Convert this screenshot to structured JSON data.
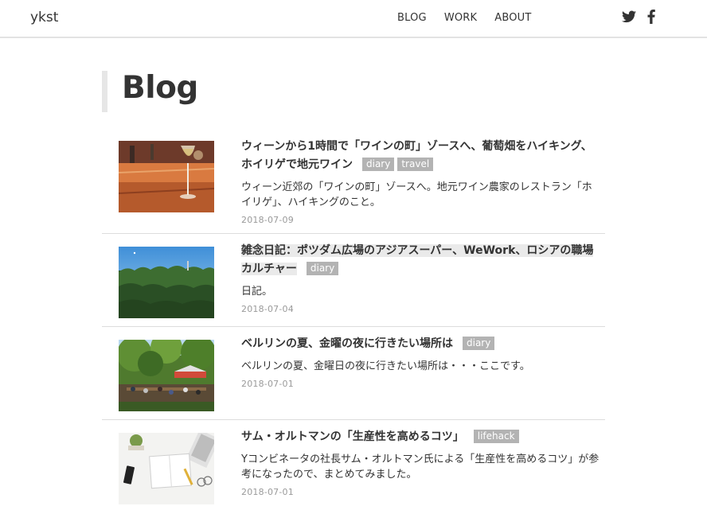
{
  "header": {
    "logo": "ykst",
    "nav": [
      "BLOG",
      "WORK",
      "ABOUT"
    ],
    "social": [
      "twitter-icon",
      "facebook-icon"
    ]
  },
  "page": {
    "title": "Blog"
  },
  "posts": [
    {
      "title": "ウィーンから1時間で「ワインの町」ゾースへ、葡萄畑をハイキング、ホイリゲで地元ワイン",
      "tags": [
        "diary",
        "travel"
      ],
      "excerpt": "ウィーン近郊の「ワインの町」ゾースへ。地元ワイン農家のレストラン「ホイリゲ」、ハイキングのこと。",
      "date": "2018-07-09"
    },
    {
      "title": "雑念日記：ポツダム広場のアジアスーパー、WeWork、ロシアの職場カルチャー",
      "tags": [
        "diary"
      ],
      "excerpt": "日記。",
      "date": "2018-07-04"
    },
    {
      "title": "ベルリンの夏、金曜の夜に行きたい場所は",
      "tags": [
        "diary"
      ],
      "excerpt": "ベルリンの夏、金曜日の夜に行きたい場所は・・・ここです。",
      "date": "2018-07-01"
    },
    {
      "title": "サム・オルトマンの「生産性を高めるコツ」",
      "tags": [
        "lifehack"
      ],
      "excerpt": "Yコンビネータの社長サム・オルトマン氏による「生産性を高めるコツ」が参考になったので、まとめてみました。",
      "date": "2018-07-01"
    }
  ]
}
